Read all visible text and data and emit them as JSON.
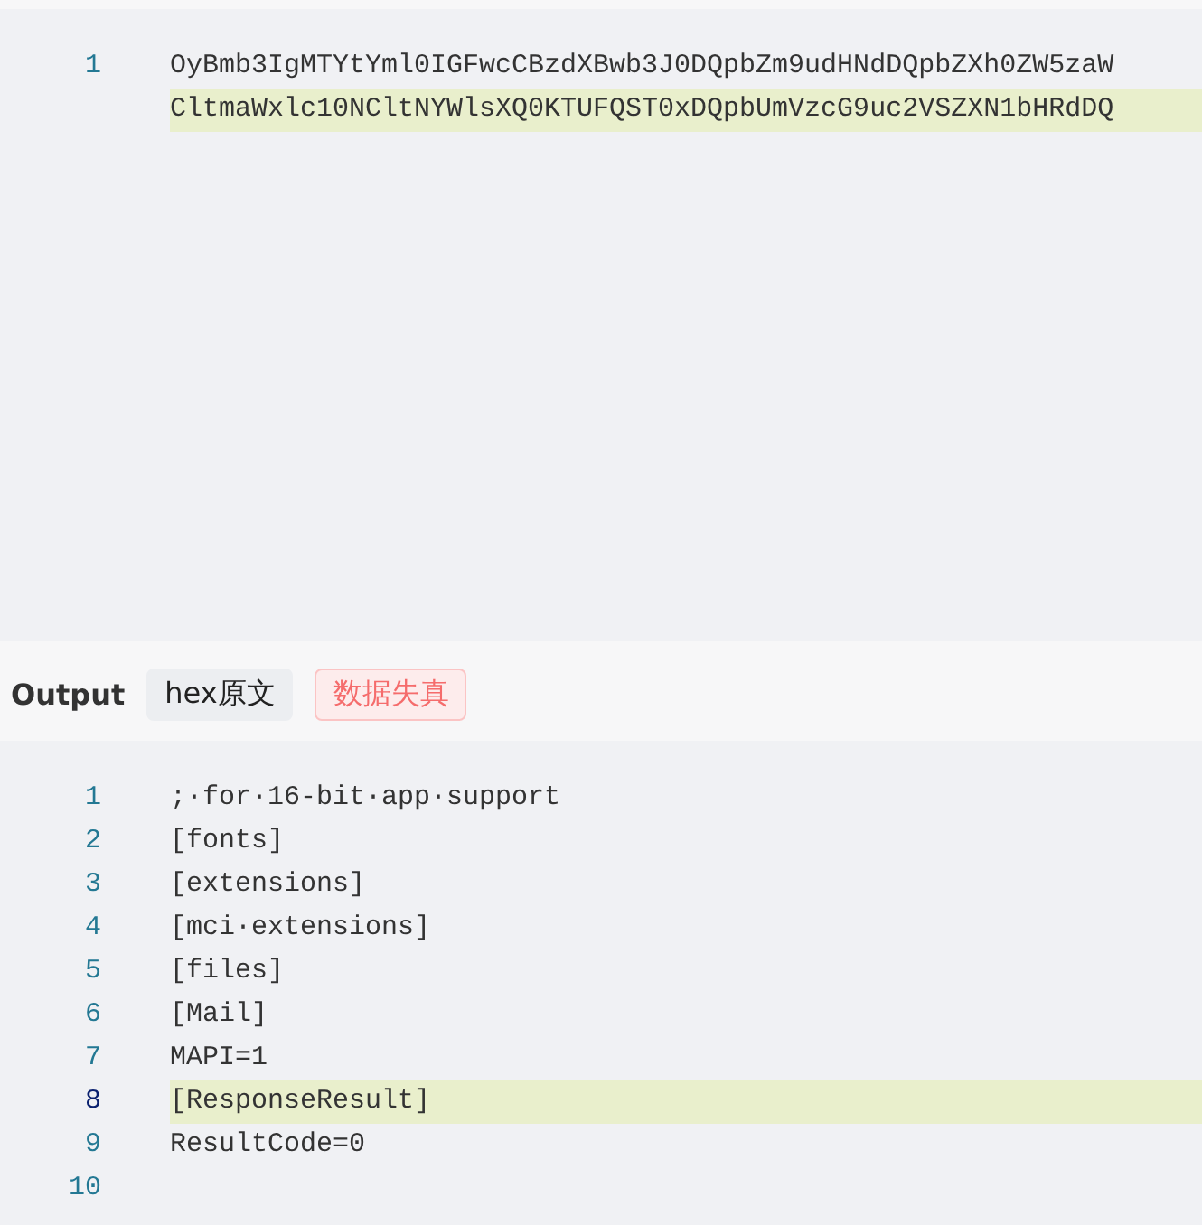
{
  "input_editor": {
    "lines": [
      {
        "number": "1",
        "segments": [
          {
            "text": "OyBmb3IgMTYtYml0IGFwcCBzdXBwb3J0DQpbZm9udHNdDQpbZXh0ZW5zaW",
            "highlighted": false
          },
          {
            "text": "CltmaWxlc10NCltNYWlsXQ0KTUFQST0xDQpbUmVzcG9uc2VSZXN1bHRdDQ",
            "highlighted": true
          }
        ]
      }
    ]
  },
  "output_bar": {
    "title": "Output",
    "tags": [
      {
        "label": "hex原文",
        "kind": "neutral"
      },
      {
        "label": "数据失真",
        "kind": "warning"
      }
    ]
  },
  "output_editor": {
    "lines": [
      {
        "number": "1",
        "text": ";·for·16-bit·app·support",
        "active": false
      },
      {
        "number": "2",
        "text": "[fonts]",
        "active": false
      },
      {
        "number": "3",
        "text": "[extensions]",
        "active": false
      },
      {
        "number": "4",
        "text": "[mci·extensions]",
        "active": false
      },
      {
        "number": "5",
        "text": "[files]",
        "active": false
      },
      {
        "number": "6",
        "text": "[Mail]",
        "active": false
      },
      {
        "number": "7",
        "text": "MAPI=1",
        "active": false
      },
      {
        "number": "8",
        "text": "[ResponseResult]",
        "active": true
      },
      {
        "number": "9",
        "text": "ResultCode=0",
        "active": false
      },
      {
        "number": "10",
        "active": false
      }
    ]
  }
}
